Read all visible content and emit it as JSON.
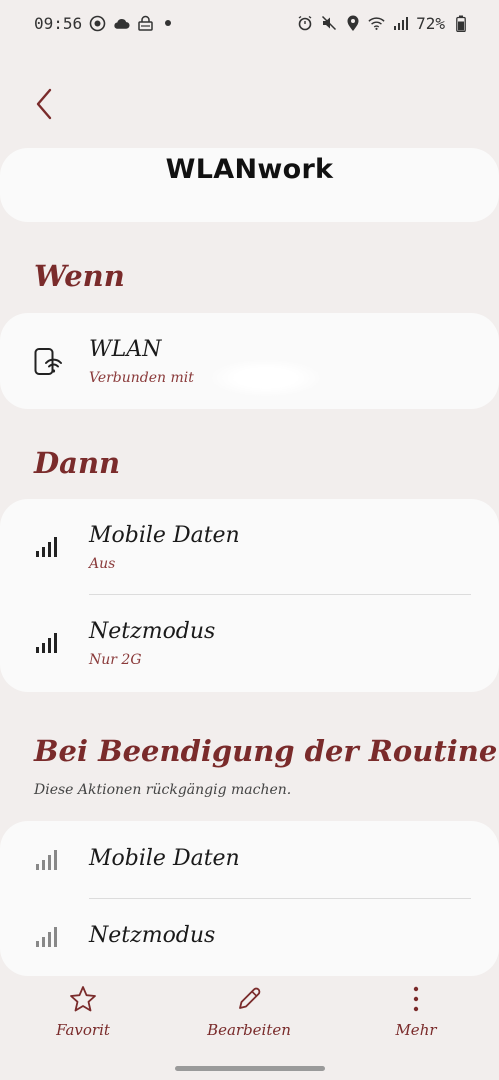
{
  "status_bar": {
    "time": "09:56",
    "battery": "72%",
    "left_icons": [
      "whatsapp-icon",
      "cloud-icon",
      "vpn-icon"
    ],
    "right_icons": [
      "alarm-icon",
      "mute-icon",
      "location-icon",
      "wifi-icon",
      "signal-icon",
      "battery-icon"
    ]
  },
  "header": {
    "title": "WLANwork"
  },
  "when": {
    "heading": "Wenn",
    "item": {
      "label": "WLAN",
      "sub": "Verbunden mit"
    }
  },
  "then": {
    "heading": "Dann",
    "items": [
      {
        "label": "Mobile Daten",
        "sub": "Aus"
      },
      {
        "label": "Netzmodus",
        "sub": "Nur 2G"
      }
    ]
  },
  "end": {
    "heading": "Bei Beendigung der Routine",
    "subheading": "Diese Aktionen rückgängig machen.",
    "items": [
      {
        "label": "Mobile Daten"
      },
      {
        "label": "Netzmodus"
      }
    ]
  },
  "bottom_nav": {
    "favorite": "Favorit",
    "edit": "Bearbeiten",
    "more": "Mehr"
  },
  "colors": {
    "accent": "#7a2b2b",
    "background": "#f2eeed",
    "card": "#fafafa"
  }
}
